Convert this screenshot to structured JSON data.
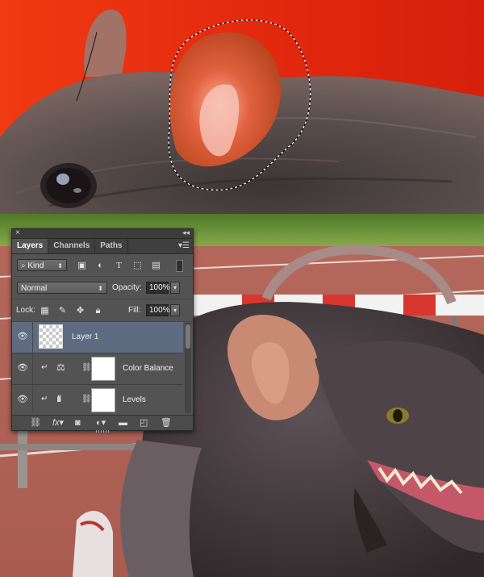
{
  "layers_panel": {
    "tabs": [
      {
        "label": "Layers",
        "active": true
      },
      {
        "label": "Channels",
        "active": false
      },
      {
        "label": "Paths",
        "active": false
      }
    ],
    "filter": {
      "kind_label": "Kind"
    },
    "blend_mode": "Normal",
    "opacity_label": "Opacity:",
    "opacity_value": "100%",
    "lock_label": "Lock:",
    "fill_label": "Fill:",
    "fill_value": "100%",
    "layers": [
      {
        "name": "Layer 1",
        "type": "pixel",
        "selected": true,
        "visible": true
      },
      {
        "name": "Color Balance",
        "type": "adjustment",
        "icon": "balance-scale-icon",
        "clipped": true,
        "visible": true
      },
      {
        "name": "Levels",
        "type": "adjustment",
        "icon": "histogram-icon",
        "clipped": true,
        "visible": true
      }
    ],
    "bottom_icons": [
      "link-icon",
      "fx-icon",
      "add-mask-icon",
      "new-adjustment-icon",
      "folder-icon",
      "new-layer-icon",
      "trash-icon"
    ],
    "colors": {
      "panel": "#535353",
      "selected_row": "#5e6b80",
      "tab_bar": "#3f3f3f"
    }
  }
}
